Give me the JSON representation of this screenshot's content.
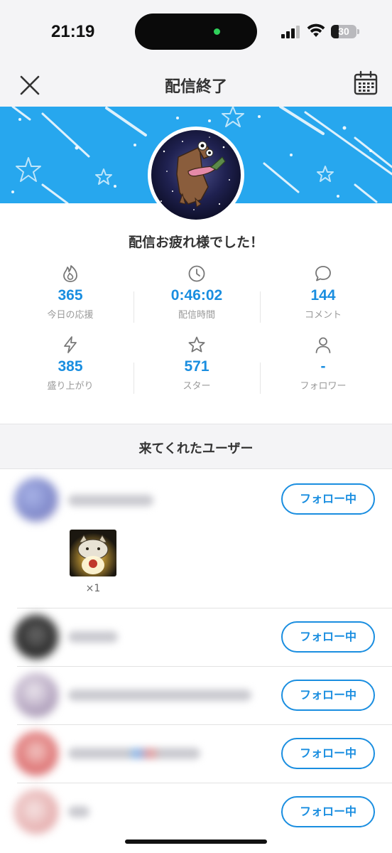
{
  "status_bar": {
    "time": "21:19",
    "battery": "30",
    "battery_level": 0.3
  },
  "header": {
    "title": "配信終了",
    "close_icon": "close-icon",
    "calendar_icon": "calendar-icon"
  },
  "banner": {
    "color": "#27a7ee",
    "decoration": "shooting-stars"
  },
  "congrats_message": "配信お疲れ様でした！",
  "stats": [
    {
      "icon": "flame-icon",
      "value": "365",
      "label": "今日の応援"
    },
    {
      "icon": "clock-icon",
      "value": "0:46:02",
      "label": "配信時間"
    },
    {
      "icon": "comment-icon",
      "value": "144",
      "label": "コメント"
    },
    {
      "icon": "lightning-icon",
      "value": "385",
      "label": "盛り上がり"
    },
    {
      "icon": "star-icon",
      "value": "571",
      "label": "スター"
    },
    {
      "icon": "user-icon",
      "value": "-",
      "label": "フォロワー"
    }
  ],
  "section_title": "来てくれたユーザー",
  "users": [
    {
      "follow_label": "フォロー中",
      "gift": {
        "icon": "gift-icon",
        "count": "×1"
      }
    },
    {
      "follow_label": "フォロー中"
    },
    {
      "follow_label": "フォロー中"
    },
    {
      "follow_label": "フォロー中"
    },
    {
      "follow_label": "フォロー中"
    }
  ],
  "colors": {
    "accent": "#1a8ee0",
    "banner": "#27a7ee",
    "background": "#f4f4f6"
  }
}
